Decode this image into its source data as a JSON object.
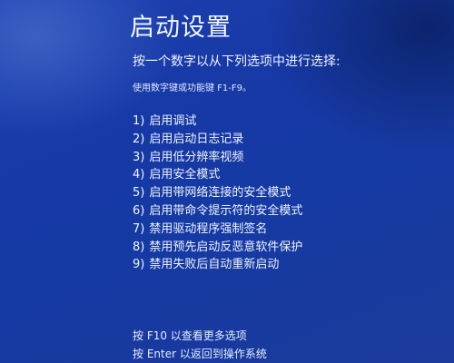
{
  "title": "启动设置",
  "instruction": "按一个数字以从下列选项中进行选择:",
  "hint": "使用数字键或功能键 F1-F9。",
  "options": [
    {
      "number": "1)",
      "label": "启用调试"
    },
    {
      "number": "2)",
      "label": "启用启动日志记录"
    },
    {
      "number": "3)",
      "label": "启用低分辨率视频"
    },
    {
      "number": "4)",
      "label": "启用安全模式"
    },
    {
      "number": "5)",
      "label": "启用带网络连接的安全模式"
    },
    {
      "number": "6)",
      "label": "启用带命令提示符的安全模式"
    },
    {
      "number": "7)",
      "label": "禁用驱动程序强制签名"
    },
    {
      "number": "8)",
      "label": "禁用预先启动反恶意软件保护"
    },
    {
      "number": "9)",
      "label": "禁用失败后自动重新启动"
    }
  ],
  "footer": {
    "more_options": "按 F10 以查看更多选项",
    "return": "按 Enter 以返回到操作系统"
  }
}
